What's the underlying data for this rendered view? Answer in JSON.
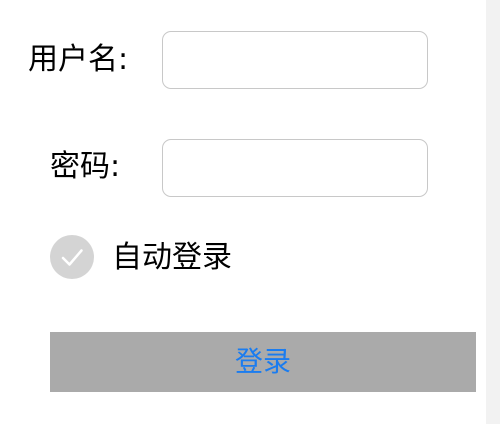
{
  "form": {
    "username_label": "用户名:",
    "username_value": "",
    "password_label": "密码:",
    "password_value": "",
    "auto_login_label": "自动登录",
    "auto_login_checked": true,
    "login_button_label": "登录"
  },
  "colors": {
    "button_background": "#aaaaaa",
    "button_text": "#1a7cf0",
    "checkbox_background": "#d4d4d4",
    "checkmark": "#ffffff",
    "field_border": "#c8c8c8"
  },
  "icons": {
    "checkbox": "check-icon"
  }
}
